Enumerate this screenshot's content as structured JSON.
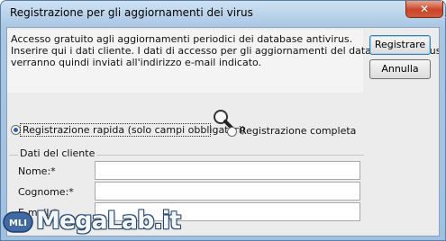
{
  "window": {
    "title": "Registrazione per gli aggiornamenti dei virus",
    "close_label": "✕"
  },
  "info": {
    "line1": "Accesso gratuito agli aggiornamenti periodici dei database antivirus.",
    "line2": "Inserire qui i dati cliente. I dati di accesso per gli aggiornamenti del database antivirus",
    "line3": "verranno quindi inviati all'indirizzo e-mail indicato."
  },
  "buttons": {
    "register": "Registrare",
    "cancel": "Annulla"
  },
  "registration_type": {
    "quick_label": "Registrazione rapida (solo campi obbligatori)",
    "quick_selected": true,
    "full_label": "Registrazione completa",
    "full_selected": false
  },
  "customer": {
    "group_title": "Dati del cliente",
    "name_label": "Nome:*",
    "surname_label": "Cognome:*",
    "email_label": "E-mail:*",
    "name_value": "",
    "surname_value": "",
    "email_value": ""
  },
  "watermark": {
    "logo_text": "MegaLab.it",
    "badge_text": "MLI"
  },
  "colors": {
    "title_bar": "#a9c7e3",
    "close_button": "#c8452a",
    "radio_selected": "#2b62b8"
  }
}
